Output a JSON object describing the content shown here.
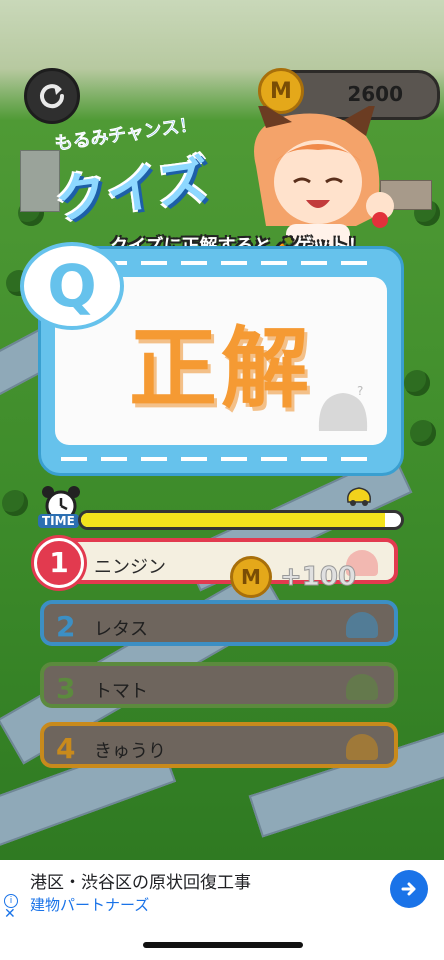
{
  "hud": {
    "back_icon": "refresh-icon",
    "coin_letter": "M",
    "coin_total": "2600"
  },
  "banner": {
    "small": "もるみチャンス！",
    "big": "クイズ",
    "subtitle": "クイズに正解すると🥕ゲット！"
  },
  "quiz": {
    "badge": "Q",
    "result": "正解",
    "time_label": "TIME",
    "time_remaining": 0.95
  },
  "reward": {
    "coin_letter": "M",
    "amount": "+100"
  },
  "options": [
    {
      "num": "1",
      "label": "ニンジン",
      "bg": "#f4efe0",
      "border": "#e23a4f",
      "numcolor": "#ffffff",
      "numbg": "#e23a4f"
    },
    {
      "num": "2",
      "label": "レタス",
      "bg": "#6e655d",
      "border": "#3c8fc4",
      "numcolor": "#3c8fc4",
      "numbg": ""
    },
    {
      "num": "3",
      "label": "トマト",
      "bg": "#6e655d",
      "border": "#5c8a3e",
      "numcolor": "#5c8a3e",
      "numbg": ""
    },
    {
      "num": "4",
      "label": "きゅうり",
      "bg": "#6e655d",
      "border": "#c88a1c",
      "numcolor": "#c88a1c",
      "numbg": ""
    }
  ],
  "ad": {
    "title": "港区・渋谷区の原状回復工事",
    "subtitle": "建物パートナーズ",
    "info_icon": "info-icon",
    "close_icon": "close-icon",
    "cta_icon": "arrow-right-icon"
  }
}
